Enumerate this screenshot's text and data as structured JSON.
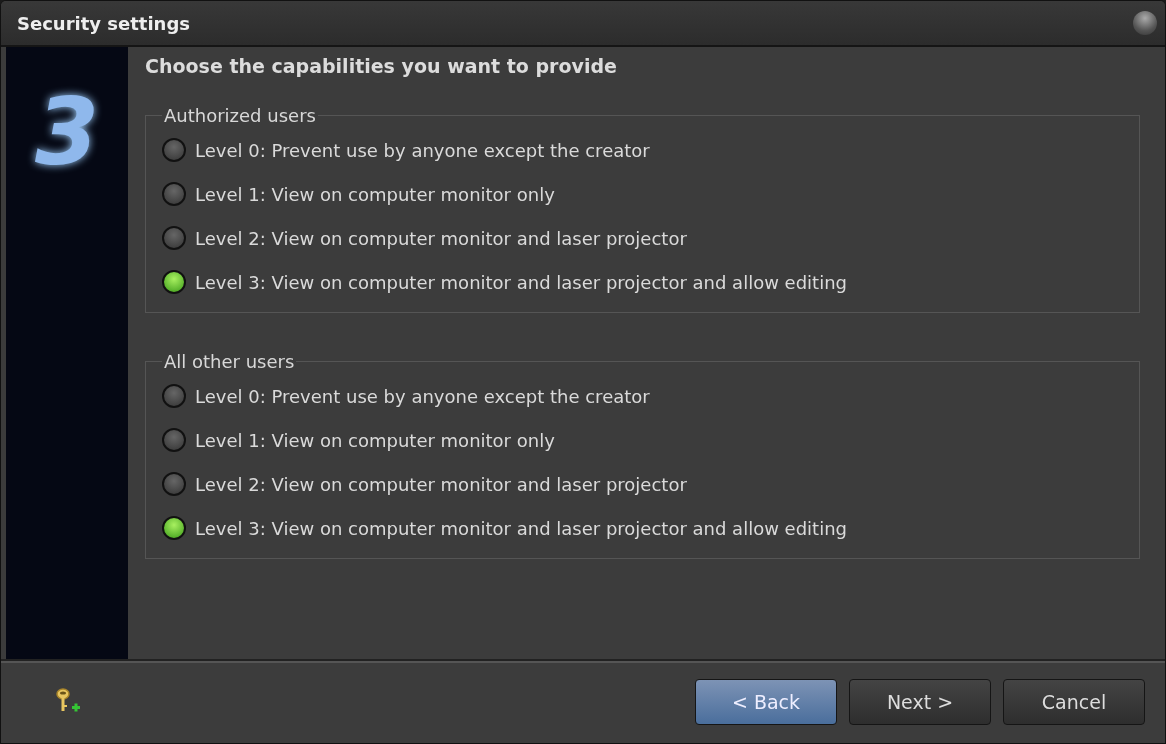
{
  "window": {
    "title": "Security settings"
  },
  "logo": "3",
  "heading": "Choose the capabilities you want to provide",
  "groups": [
    {
      "title": "Authorized users",
      "options": [
        {
          "label": "Level 0: Prevent use by anyone except the creator",
          "selected": false
        },
        {
          "label": "Level 1: View on computer monitor only",
          "selected": false
        },
        {
          "label": "Level 2: View on computer monitor and laser projector",
          "selected": false
        },
        {
          "label": "Level 3: View on computer monitor and laser projector and allow editing",
          "selected": true
        }
      ]
    },
    {
      "title": "All other users",
      "options": [
        {
          "label": "Level 0: Prevent use by anyone except the creator",
          "selected": false
        },
        {
          "label": "Level 1: View on computer monitor only",
          "selected": false
        },
        {
          "label": "Level 2: View on computer monitor and laser projector",
          "selected": false
        },
        {
          "label": "Level 3: View on computer monitor and laser projector and allow editing",
          "selected": true
        }
      ]
    }
  ],
  "buttons": [
    {
      "label": "< Back",
      "focused": true
    },
    {
      "label": "Next >",
      "focused": false
    },
    {
      "label": "Cancel",
      "focused": false
    }
  ]
}
